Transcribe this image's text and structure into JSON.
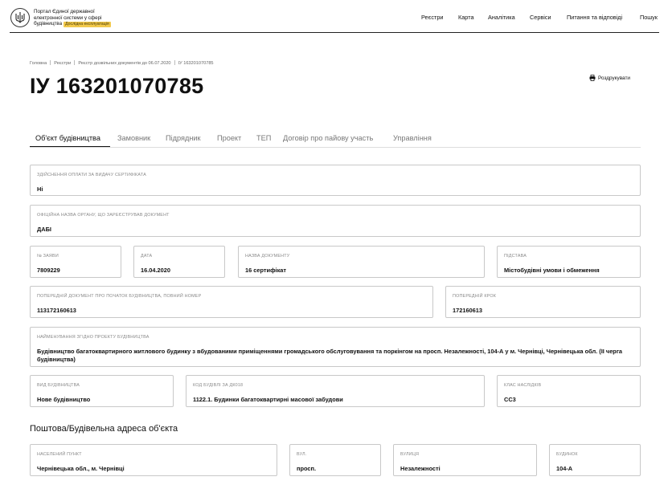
{
  "header": {
    "portal_line1": "Портал Єдиної державної",
    "portal_line2": "електронної системи у сфері",
    "portal_line3": "будівництва",
    "beta_badge": "Дослідна експлуатація",
    "nav": [
      "Реєстри",
      "Карта",
      "Аналітика",
      "Сервіси",
      "Питання та відповіді",
      "Пошук"
    ]
  },
  "breadcrumb": [
    "Головна",
    "Реєстри",
    "Реєстр дозвільних документів до 06.07.2020",
    "ІУ 163201070785"
  ],
  "page": {
    "title": "ІУ 163201070785",
    "print_label": "Роздрукувати"
  },
  "tabs": [
    "Об'єкт будівництва",
    "Замовник",
    "Підрядник",
    "Проект",
    "ТЕП",
    "Договір про пайову участь",
    "Управління"
  ],
  "fields": {
    "payment": {
      "label": "Здійснення оплати за видачу сертифіката",
      "value": "Ні"
    },
    "authority": {
      "label": "Офіційна назва органу, що зареєстрував документ",
      "value": "ДАБІ"
    },
    "app_number": {
      "label": "№ заяви",
      "value": "7809229"
    },
    "date": {
      "label": "Дата",
      "value": "16.04.2020"
    },
    "doc_name": {
      "label": "Назва документу",
      "value": "16 сертифікат"
    },
    "basis": {
      "label": "Підстава",
      "value": "Містобудівні умови і обмеження"
    },
    "prev_doc": {
      "label": "Попередній документ про початок будівництва, повний номер",
      "value": "113172160613"
    },
    "prev_step": {
      "label": "Попередній крок",
      "value": "172160613"
    },
    "project_name": {
      "label": "Найменування згідно проекту будівництва",
      "value": "Будівництво багатоквартирного житлового будинку з вбудованими приміщеннями громадського обслуговування та поркінгом на просп. Незалежності, 104-А у м. Чернівці, Чернівецька обл. (ІІ черга будівництва)"
    },
    "construction_type": {
      "label": "Вид будівництва",
      "value": "Нове будівництво"
    },
    "building_code": {
      "label": "Код будівлі за ДК018",
      "value": "1122.1. Будинки багатоквартирні масової забудови"
    },
    "consequence_class": {
      "label": "Клас наслідків",
      "value": "СС3"
    }
  },
  "address": {
    "section_title": "Поштова/Будівельна адреса об'єкта",
    "settlement": {
      "label": "Населений пункт",
      "value": "Чернівецька обл., м. Чернівці"
    },
    "street_type": {
      "label": "Вул.",
      "value": "просп."
    },
    "street": {
      "label": "Вулиця",
      "value": "Незалежності"
    },
    "building": {
      "label": "Будинок",
      "value": "104-А"
    }
  },
  "icons": {
    "logo": "trident-icon",
    "print": "printer-icon"
  }
}
